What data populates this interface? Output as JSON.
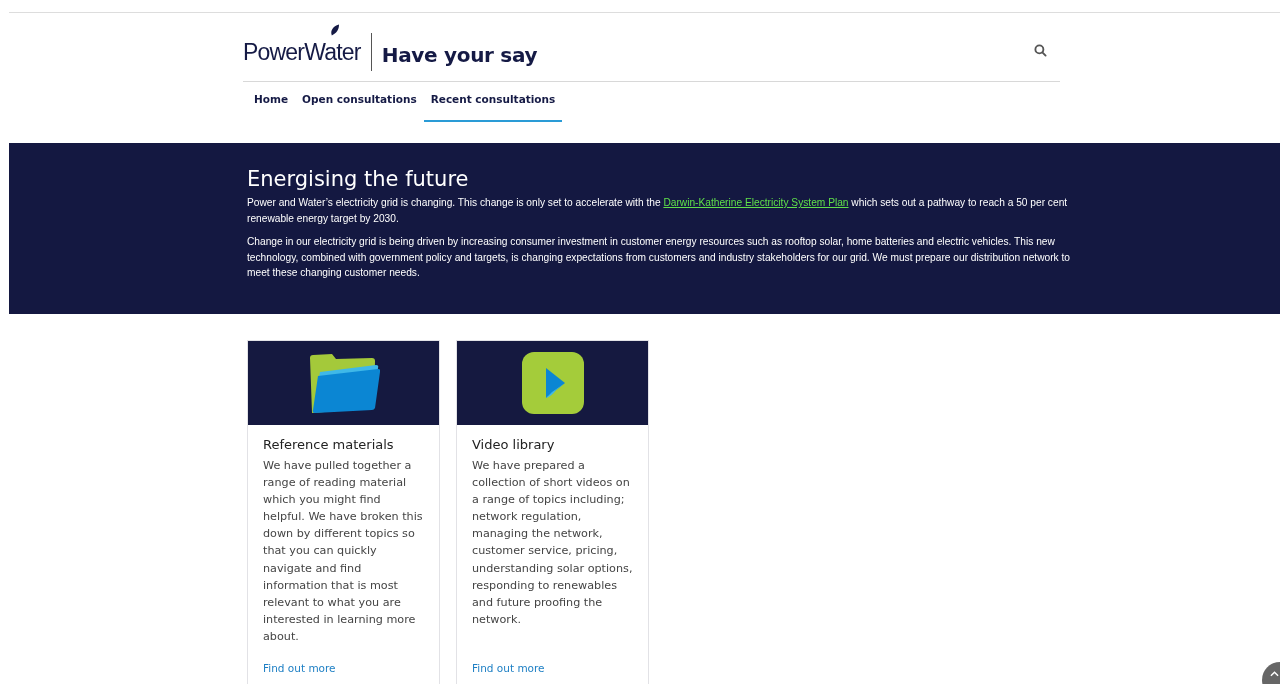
{
  "header": {
    "logo": "PowerWater",
    "site_title": "Have your say"
  },
  "nav": [
    {
      "label": "Home",
      "selected": false
    },
    {
      "label": "Open consultations",
      "selected": false
    },
    {
      "label": "Recent consultations",
      "selected": true
    }
  ],
  "banner": {
    "title": "Energising the future",
    "paragraphs": [
      {
        "before": "Power and Water’s electricity grid is changing. This change is only set to accelerate with the ",
        "link": "Darwin-Katherine Electricity System Plan",
        "after": " which sets out a pathway to reach a 50 per cent renewable energy target by 2030."
      },
      {
        "before": "Change in our electricity grid is being driven by increasing consumer investment in customer energy resources such as rooftop solar, home batteries and electric vehicles. This new technology, combined with government policy and targets, is changing expectations from customers and industry stakeholders for our grid. We must prepare our distribution network to meet these changing customer needs."
      }
    ]
  },
  "cards": [
    {
      "kind": "folder",
      "title": "Reference materials",
      "text": "We have pulled together a range of reading material which you might find helpful. We have broken this down by different topics so that you can quickly navigate and find information that is most relevant to what you are interested in learning more about.",
      "link": "Find out more"
    },
    {
      "kind": "video",
      "title": "Video library",
      "text": "We have prepared a collection of short videos on a range of topics including; network regulation, managing the network, customer service, pricing, understanding solar options, responding to renewables and future proofing the network.",
      "link": "Find out more"
    }
  ]
}
